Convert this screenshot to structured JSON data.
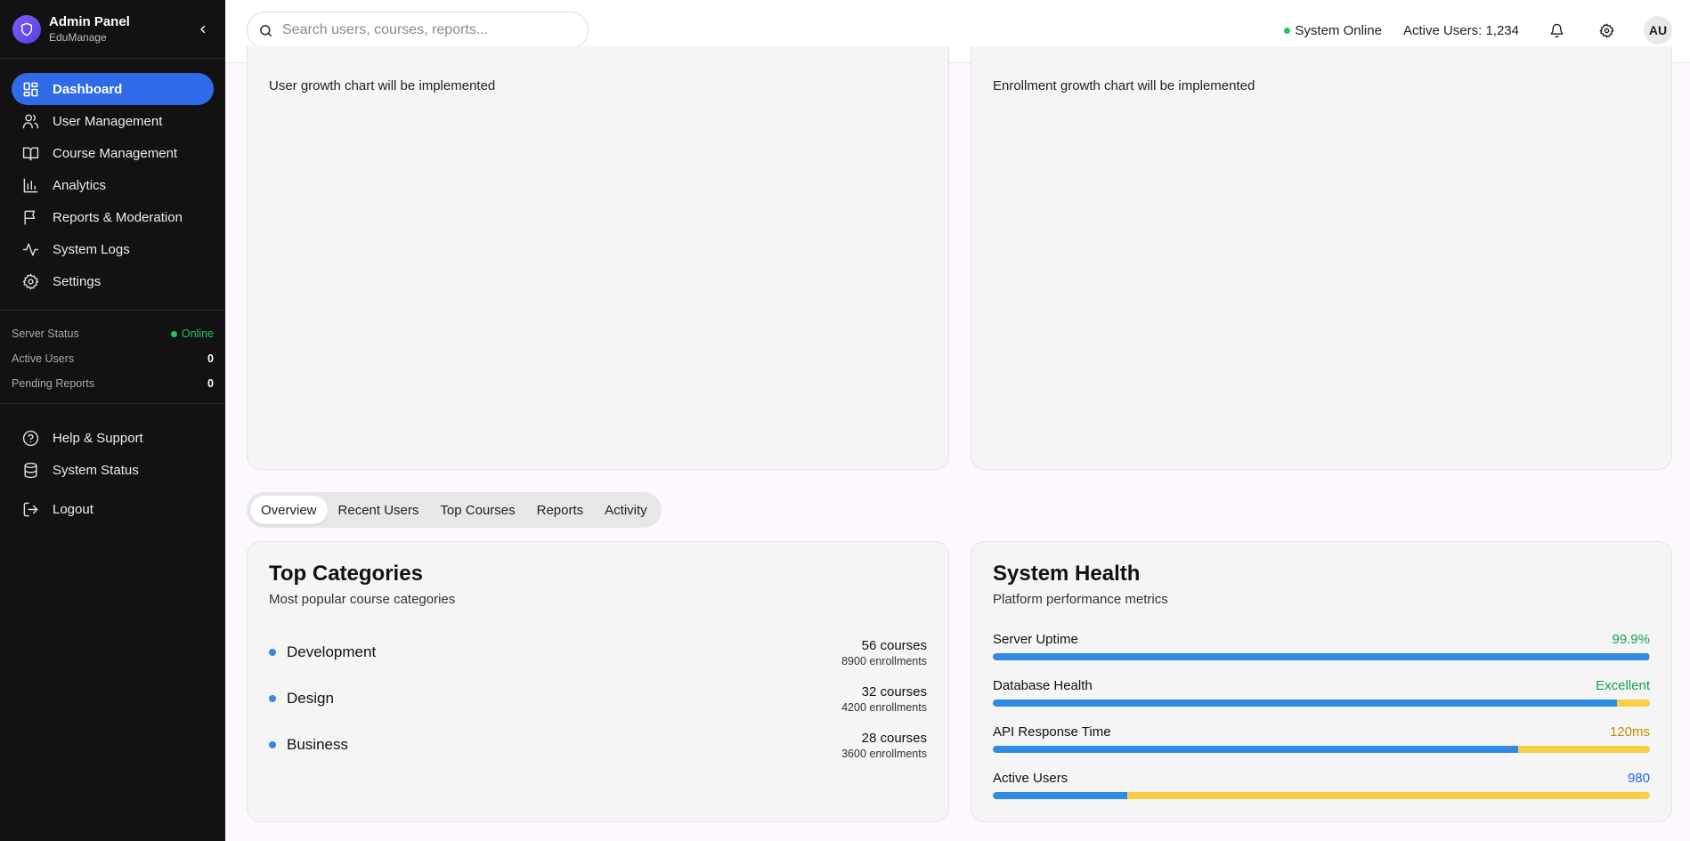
{
  "brand": {
    "title": "Admin Panel",
    "subtitle": "EduManage"
  },
  "nav": [
    {
      "label": "Dashboard",
      "icon": "dashboard-icon",
      "active": true
    },
    {
      "label": "User Management",
      "icon": "users-icon"
    },
    {
      "label": "Course Management",
      "icon": "book-icon"
    },
    {
      "label": "Analytics",
      "icon": "bar-chart-icon"
    },
    {
      "label": "Reports & Moderation",
      "icon": "flag-icon"
    },
    {
      "label": "System Logs",
      "icon": "activity-icon"
    },
    {
      "label": "Settings",
      "icon": "gear-icon"
    }
  ],
  "sidebar_status": {
    "server_label": "Server Status",
    "server_value": "Online",
    "active_label": "Active Users",
    "active_value": "0",
    "pending_label": "Pending Reports",
    "pending_value": "0"
  },
  "nav_bottom": [
    {
      "label": "Help & Support",
      "icon": "help-circle-icon"
    },
    {
      "label": "System Status",
      "icon": "database-icon"
    },
    {
      "label": "Logout",
      "icon": "logout-icon"
    }
  ],
  "topbar": {
    "search_placeholder": "Search users, courses, reports...",
    "system_status": "System Online",
    "active_users": "Active Users: 1,234",
    "avatar_initials": "AU"
  },
  "charts": {
    "user_growth_text": "User growth chart will be implemented",
    "enrollment_growth_text": "Enrollment growth chart will be implemented"
  },
  "tabs": [
    "Overview",
    "Recent Users",
    "Top Courses",
    "Reports",
    "Activity"
  ],
  "top_categories": {
    "title": "Top Categories",
    "subtitle": "Most popular course categories",
    "items": [
      {
        "name": "Development",
        "courses": "56 courses",
        "enrollments": "8900 enrollments"
      },
      {
        "name": "Design",
        "courses": "32 courses",
        "enrollments": "4200 enrollments"
      },
      {
        "name": "Business",
        "courses": "28 courses",
        "enrollments": "3600 enrollments"
      }
    ]
  },
  "system_health": {
    "title": "System Health",
    "subtitle": "Platform performance metrics",
    "metrics": [
      {
        "label": "Server Uptime",
        "value": "99.9%",
        "value_color": "#16a34a",
        "fill": 0.999
      },
      {
        "label": "Database Health",
        "value": "Excellent",
        "value_color": "#16a34a",
        "fill": 0.95
      },
      {
        "label": "API Response Time",
        "value": "120ms",
        "value_color": "#ca8a04",
        "fill": 0.8
      },
      {
        "label": "Active Users",
        "value": "980",
        "value_color": "#2563eb",
        "fill": 0.204
      }
    ]
  },
  "colors": {
    "accent": "#2f6be8",
    "sidebar_bg": "#121212",
    "online": "#22c55e",
    "bar_fill": "#2f8be6",
    "bar_track": "#f6cf45"
  }
}
